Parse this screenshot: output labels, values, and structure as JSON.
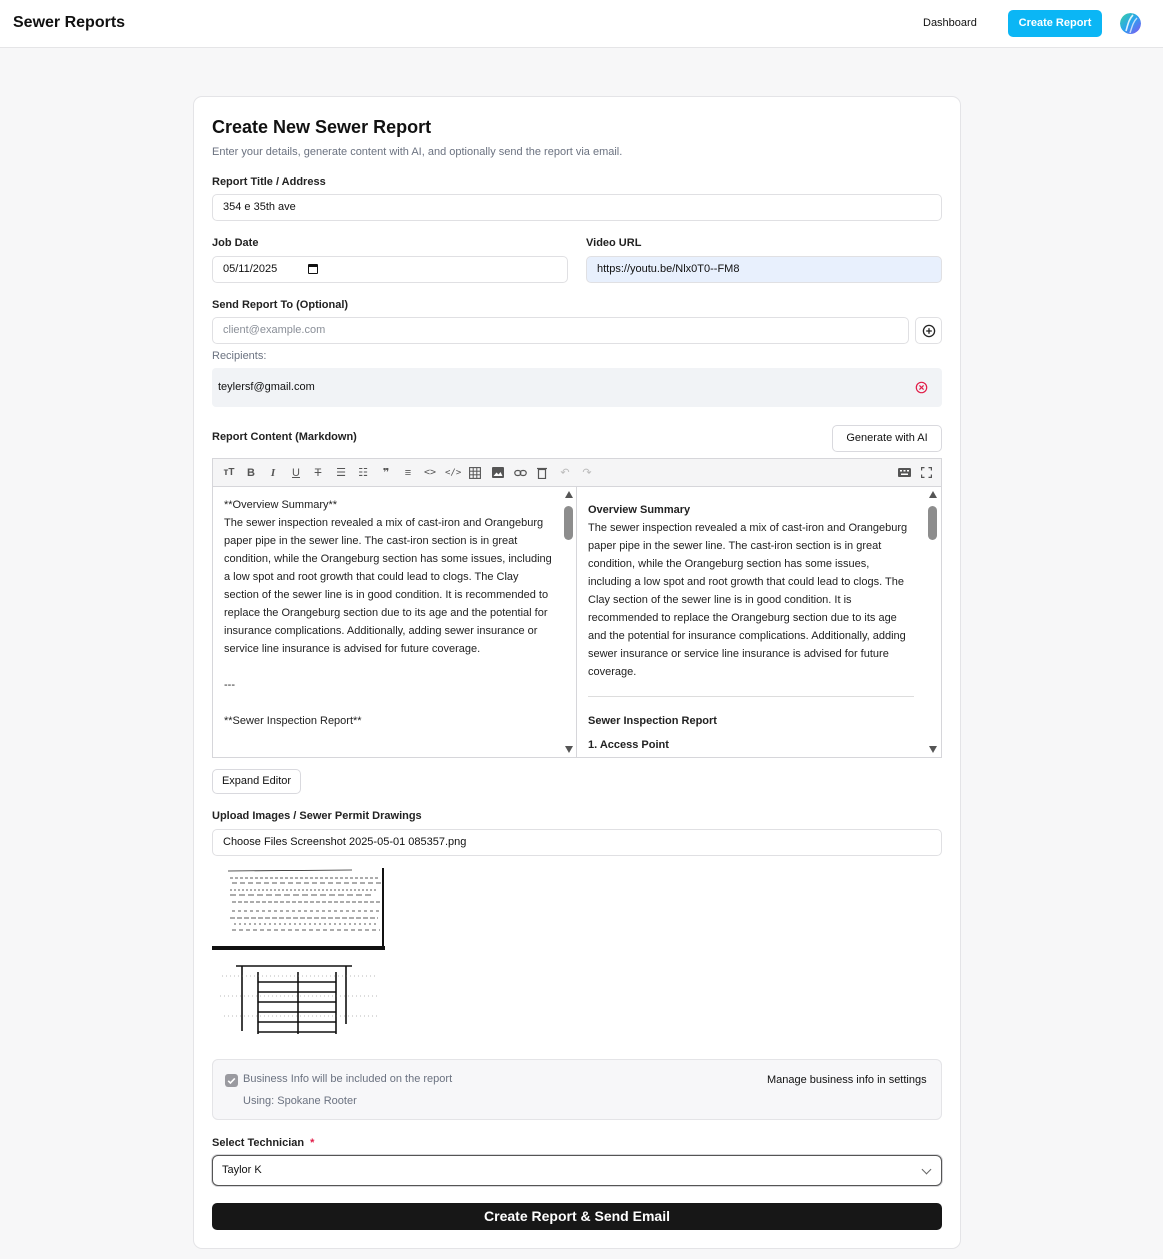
{
  "nav": {
    "brand": "Sewer Reports",
    "dashboard_label": "Dashboard",
    "create_label": "Create Report"
  },
  "form": {
    "title": "Create New Sewer Report",
    "subtitle": "Enter your details, generate content with AI, and optionally send the report via email.",
    "report_title_label": "Report Title / Address",
    "report_title_value": "354 e 35th ave",
    "job_date_label": "Job Date",
    "job_date_value": "05/11/2025",
    "video_url_label": "Video URL",
    "video_url_value": "https://youtu.be/Nlx0T0--FM8",
    "send_to_label": "Send Report To (Optional)",
    "send_to_placeholder": "client@example.com",
    "recipients_label": "Recipients:",
    "recipients": [
      "teylersf@gmail.com"
    ],
    "content_label": "Report Content (Markdown)",
    "generate_label": "Generate with AI",
    "expand_label": "Expand Editor",
    "upload_label": "Upload Images / Sewer Permit Drawings",
    "upload_value": "Choose Files Screenshot 2025-05-01 085357.png",
    "business_info_text": "Business Info will be included on the report",
    "business_using": "Using: Spokane Rooter",
    "business_link": "Manage business info in settings",
    "technician_label": "Select Technician",
    "technician_required": "*",
    "technician_value": "Taylor K",
    "submit_label": "Create Report & Send Email"
  },
  "editor": {
    "source": "**Overview Summary**\nThe sewer inspection revealed a mix of cast-iron and Orangeburg paper pipe in the sewer line. The cast-iron section is in great condition, while the Orangeburg section has some issues, including a low spot and root growth that could lead to clogs. The Clay section of the sewer line is in good condition. It is recommended to replace the Orangeburg section due to its age and the potential for insurance complications. Additionally, adding sewer insurance or service line insurance is advised for future coverage.\n\n---\n\n**Sewer Inspection Report**",
    "preview_heading": "Overview Summary",
    "preview_body": "The sewer inspection revealed a mix of cast-iron and Orangeburg paper pipe in the sewer line. The cast-iron section is in great condition, while the Orangeburg section has some issues, including a low spot and root growth that could lead to clogs. The Clay section of the sewer line is in good condition. It is recommended to replace the Orangeburg section due to its age and the potential for insurance complications. Additionally, adding sewer insurance or service line insurance is advised for future coverage.",
    "preview_heading2": "Sewer Inspection Report",
    "preview_heading3": "1. Access Point",
    "toolbar_icons": [
      "heading-icon",
      "bold-icon",
      "italic-icon",
      "underline-icon",
      "strikethrough-icon",
      "bullet-list-icon",
      "ordered-list-icon",
      "checklist-icon",
      "quote-icon",
      "code-icon",
      "code-block-icon",
      "table-icon",
      "image-icon",
      "link-icon",
      "clear-icon",
      "undo-icon",
      "redo-icon",
      "keyboard-icon",
      "fullscreen-icon"
    ]
  },
  "colors": {
    "accent": "#0bb6f5",
    "submit_bg": "#171717",
    "required": "#e11d48",
    "remove": "#e11d48"
  }
}
